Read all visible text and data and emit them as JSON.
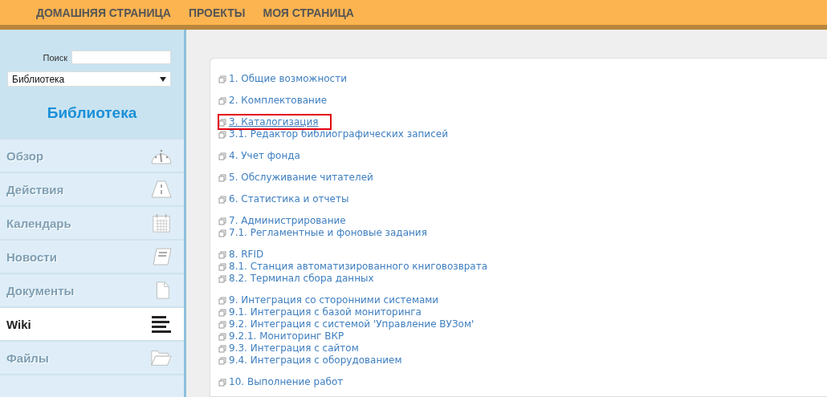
{
  "top_nav": [
    "ДОМАШНЯЯ СТРАНИЦА",
    "ПРОЕКТЫ",
    "МОЯ СТРАНИЦА"
  ],
  "sidebar": {
    "search_label": "Поиск",
    "project_select": "Библиотека",
    "title": "Библиотека",
    "items": [
      {
        "label": "Обзор",
        "kind": "gauge",
        "selected": false
      },
      {
        "label": "Действия",
        "kind": "road",
        "selected": false
      },
      {
        "label": "Календарь",
        "kind": "calendar",
        "selected": false
      },
      {
        "label": "Новости",
        "kind": "news",
        "selected": false
      },
      {
        "label": "Документы",
        "kind": "document",
        "selected": false
      },
      {
        "label": "Wiki",
        "kind": "lines",
        "selected": true
      },
      {
        "label": "Файлы",
        "kind": "folder",
        "selected": false
      }
    ]
  },
  "wiki_index": [
    {
      "pages": [
        {
          "label": "1. Общие возможности",
          "highlighted": false
        }
      ]
    },
    {
      "pages": [
        {
          "label": "2. Комплектование",
          "highlighted": false
        }
      ]
    },
    {
      "pages": [
        {
          "label": "3. Каталогизация",
          "highlighted": true
        },
        {
          "label": "3.1. Редактор библиографических записей",
          "highlighted": false
        }
      ]
    },
    {
      "pages": [
        {
          "label": "4. Учет фонда",
          "highlighted": false
        }
      ]
    },
    {
      "pages": [
        {
          "label": "5. Обслуживание читателей",
          "highlighted": false
        }
      ]
    },
    {
      "pages": [
        {
          "label": "6. Статистика и отчеты",
          "highlighted": false
        }
      ]
    },
    {
      "pages": [
        {
          "label": "7. Администрирование",
          "highlighted": false
        },
        {
          "label": "7.1. Регламентные и фоновые задания",
          "highlighted": false
        }
      ]
    },
    {
      "pages": [
        {
          "label": "8. RFID",
          "highlighted": false
        },
        {
          "label": "8.1. Станция автоматизированного книговозврата",
          "highlighted": false
        },
        {
          "label": "8.2. Терминал сбора данных",
          "highlighted": false
        }
      ]
    },
    {
      "pages": [
        {
          "label": "9. Интеграция со сторонними системами",
          "highlighted": false
        },
        {
          "label": "9.1. Интеграция с базой мониторинга",
          "highlighted": false
        },
        {
          "label": "9.2. Интеграция с системой 'Управление ВУЗом'",
          "highlighted": false
        },
        {
          "label": "9.2.1. Мониторинг ВКР",
          "highlighted": false
        },
        {
          "label": "9.3. Интеграция с сайтом",
          "highlighted": false
        },
        {
          "label": "9.4. Интеграция с оборудованием",
          "highlighted": false
        }
      ]
    },
    {
      "pages": [
        {
          "label": "10. Выполнение работ",
          "highlighted": false
        }
      ]
    }
  ]
}
